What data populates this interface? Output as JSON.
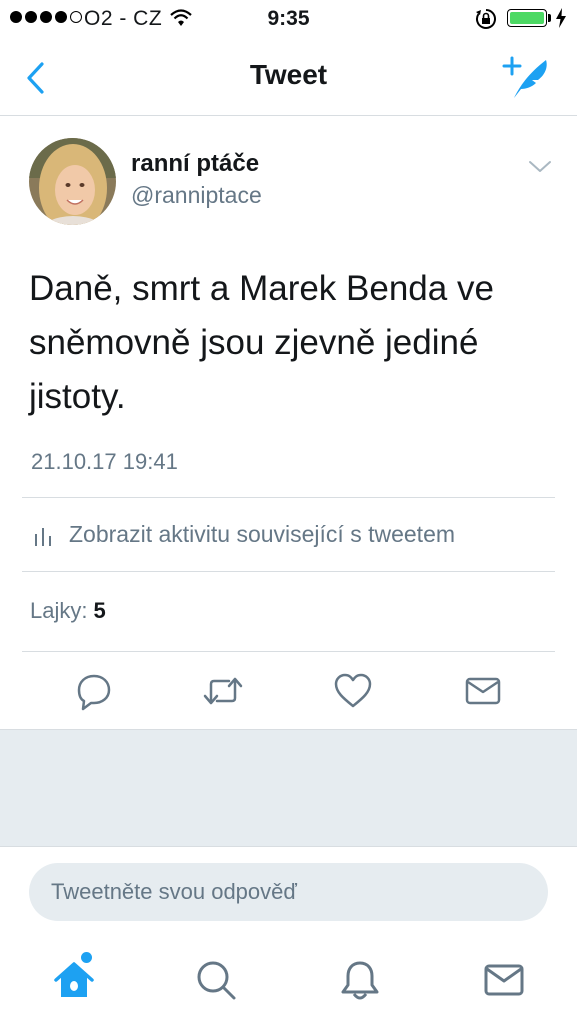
{
  "status_bar": {
    "carrier": "O2 - CZ",
    "time": "9:35",
    "signal_bars_filled": 4,
    "signal_bars_total": 5,
    "battery_level": 1.0,
    "battery_color": "#4cd964"
  },
  "nav": {
    "title": "Tweet",
    "back_icon": "chevron-left-icon",
    "compose_icon": "compose-quill-icon"
  },
  "tweet": {
    "author_name": "ranní ptáče",
    "author_handle": "@ranniptace",
    "text": "Daně, smrt a Marek Benda ve sněmovně jsou zjevně jediné jistoty.",
    "timestamp": "21.10.17 19:41",
    "activity_label": "Zobrazit aktivitu související s tweetem",
    "likes_label": "Lajky:",
    "likes_count": "5"
  },
  "actions": {
    "icons": [
      "reply-icon",
      "retweet-icon",
      "like-icon",
      "direct-message-icon"
    ]
  },
  "reply": {
    "placeholder": "Tweetněte svou odpověď"
  },
  "tab_bar": {
    "tabs": [
      "home-icon",
      "search-icon",
      "notifications-icon",
      "messages-icon"
    ],
    "active_tab": "home-icon"
  },
  "colors": {
    "accent": "#1da1f2",
    "text_primary": "#14171a",
    "text_secondary": "#657786",
    "divider": "#d8dde1",
    "background_gray": "#e6ecf0"
  }
}
